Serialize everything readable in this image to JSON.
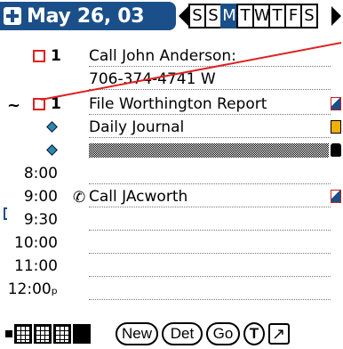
{
  "header": {
    "date": "May 26, 03",
    "week_days": [
      {
        "label": "S",
        "selected": false
      },
      {
        "label": "S",
        "selected": false
      },
      {
        "label": "M",
        "selected": true
      },
      {
        "label": "T",
        "selected": false
      },
      {
        "label": "W",
        "selected": false
      },
      {
        "label": "T",
        "selected": false
      },
      {
        "label": "F",
        "selected": false
      },
      {
        "label": "S",
        "selected": false
      }
    ]
  },
  "tasks": [
    {
      "priority": "1",
      "title": "Call John Anderson:",
      "detail": "706-374-4741 W"
    },
    {
      "priority": "1",
      "title": "File Worthington Report"
    }
  ],
  "events": [
    {
      "title": "Daily Journal"
    },
    {
      "title": ""
    }
  ],
  "schedule": [
    {
      "time": "8:00",
      "title": ""
    },
    {
      "time": "9:00",
      "title": "Call JAcworth"
    },
    {
      "time": "9:30",
      "title": ""
    },
    {
      "time": "10:00",
      "title": ""
    },
    {
      "time": "11:00",
      "title": ""
    },
    {
      "time": "12:00ₚ",
      "title": ""
    }
  ],
  "markers": {
    "tilde": "~"
  },
  "bottom": {
    "new_label": "New",
    "details_label": "Det",
    "go_label": "Go",
    "todo_label": "T"
  },
  "colors": {
    "accent": "#1b4f8a",
    "priority_box": "#e02020",
    "annotation": "#e02020"
  }
}
